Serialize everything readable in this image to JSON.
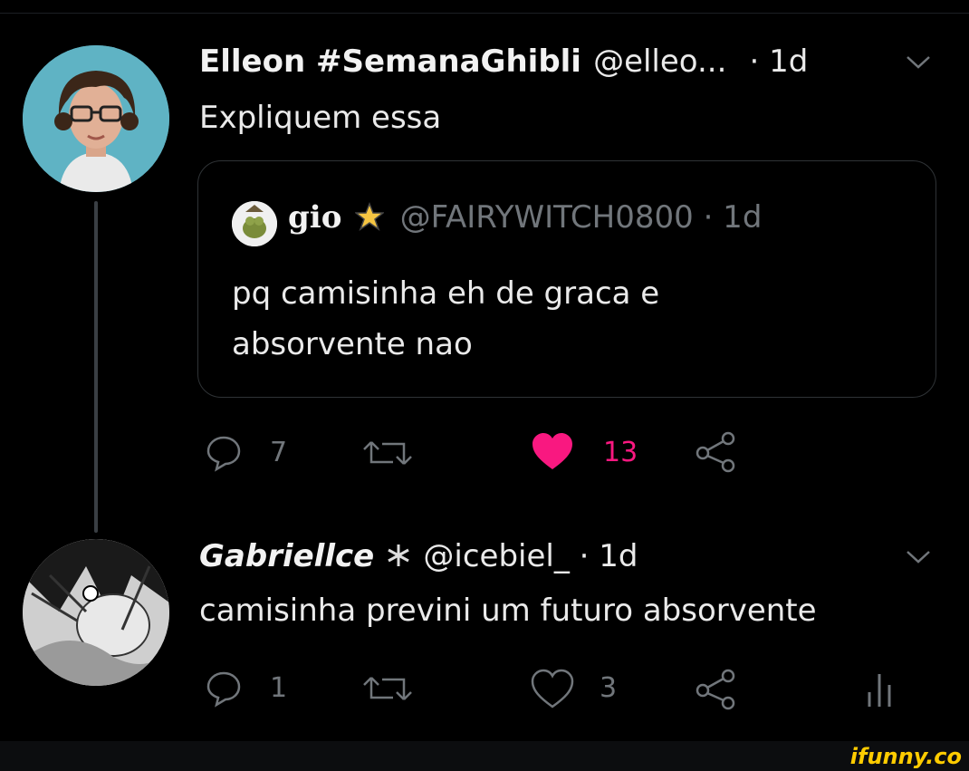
{
  "tweet1": {
    "display_name": "Elleon #SemanaGhibli",
    "handle": "@elleo...",
    "time": "· 1d",
    "text": "Expliquem essa",
    "quote": {
      "name": "gio",
      "handle": "@FAIRYWITCH0800 · 1d",
      "text_line1": "pq camisinha eh de graca e",
      "text_line2": "absorvente nao"
    },
    "replies": "7",
    "likes": "13",
    "liked": true
  },
  "tweet2": {
    "display_name": "Gabriellce",
    "handle": "@icebiel_ · 1d",
    "text": "camisinha previni um futuro absorvente",
    "replies": "1",
    "likes": "3"
  },
  "watermark": "ifunny.co",
  "colors": {
    "like": "#f91880",
    "muted": "#71767b",
    "background": "#000000"
  },
  "icons": [
    "reply-icon",
    "retweet-icon",
    "like-icon",
    "share-icon",
    "analytics-icon",
    "chevron-down-icon"
  ]
}
